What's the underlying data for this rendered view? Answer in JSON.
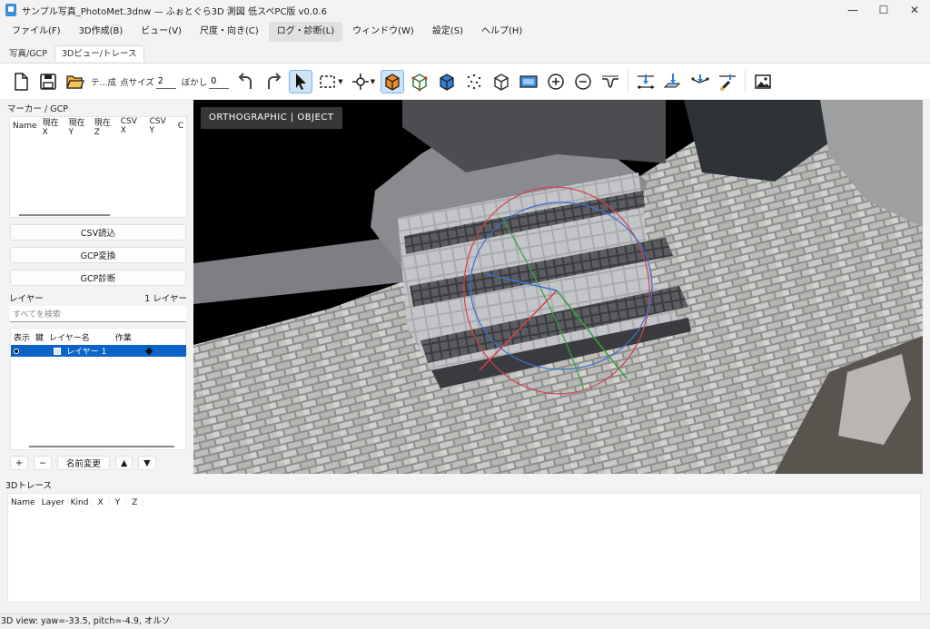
{
  "window": {
    "title": "サンプル写真_PhotoMet.3dnw — ふぉとぐら3D 測図 低スペPC版 v0.0.6",
    "controls": [
      "—",
      "☐",
      "✕"
    ]
  },
  "menu": [
    "ファイル(F)",
    "3D作成(B)",
    "ビュー(V)",
    "尺度・向き(C)",
    "ログ・診断(L)",
    "ウィンドウ(W)",
    "設定(S)",
    "ヘルプ(H)"
  ],
  "tabs": [
    "写真/GCP",
    "3Dビュー/トレース"
  ],
  "toolbar": {
    "text_label": "テ...成",
    "point_size_label": "点サイズ",
    "point_size_value": "2",
    "blur_label": "ぼかし",
    "blur_value": "0"
  },
  "markers": {
    "title": "マーカー / GCP",
    "columns": [
      "Name",
      "現在X",
      "現在Y",
      "現在Z",
      "CSV X",
      "CSV Y",
      "C"
    ],
    "csv_button": "CSV読込",
    "gcp_convert_button": "GCP変換",
    "gcp_diag_button": "GCP診断"
  },
  "layers": {
    "title": "レイヤー",
    "count": "1 レイヤー",
    "search_placeholder": "すべてを検索",
    "columns": [
      "表示",
      "鍵",
      "レイヤー名",
      "作業"
    ],
    "rows": [
      {
        "name": "レイヤー 1"
      }
    ],
    "add": "+",
    "remove": "−",
    "rename": "名前変更",
    "up": "▲",
    "down": "▼"
  },
  "viewport": {
    "mode_label": "ORTHOGRAPHIC | OBJECT"
  },
  "trace": {
    "title": "3Dトレース",
    "columns": [
      "Name",
      "Layer",
      "Kind",
      "X",
      "Y",
      "Z"
    ]
  },
  "status": "3D view: yaw=-33.5, pitch=-4.9, オルソ",
  "colors": {
    "accent": "#0a64c8",
    "tool_selected": "#cfe3f7"
  }
}
